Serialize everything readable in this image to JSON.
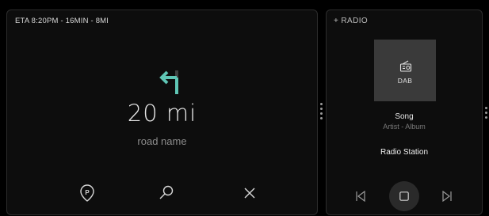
{
  "navigation": {
    "eta": "ETA 8:20PM - 16MIN - 8MI",
    "distance": "20 mi",
    "road_name": "road name",
    "turn_icon": "turn-left-arrow-icon",
    "accent_color": "#5fc6b5",
    "buttons": [
      "parking-icon",
      "search-icon",
      "close-icon"
    ]
  },
  "radio": {
    "title": "+ RADIO",
    "band": "DAB",
    "song": "Song",
    "artist_album": "Artist - Album",
    "station": "Radio Station",
    "controls": [
      "previous-icon",
      "stop-icon",
      "next-icon"
    ]
  }
}
